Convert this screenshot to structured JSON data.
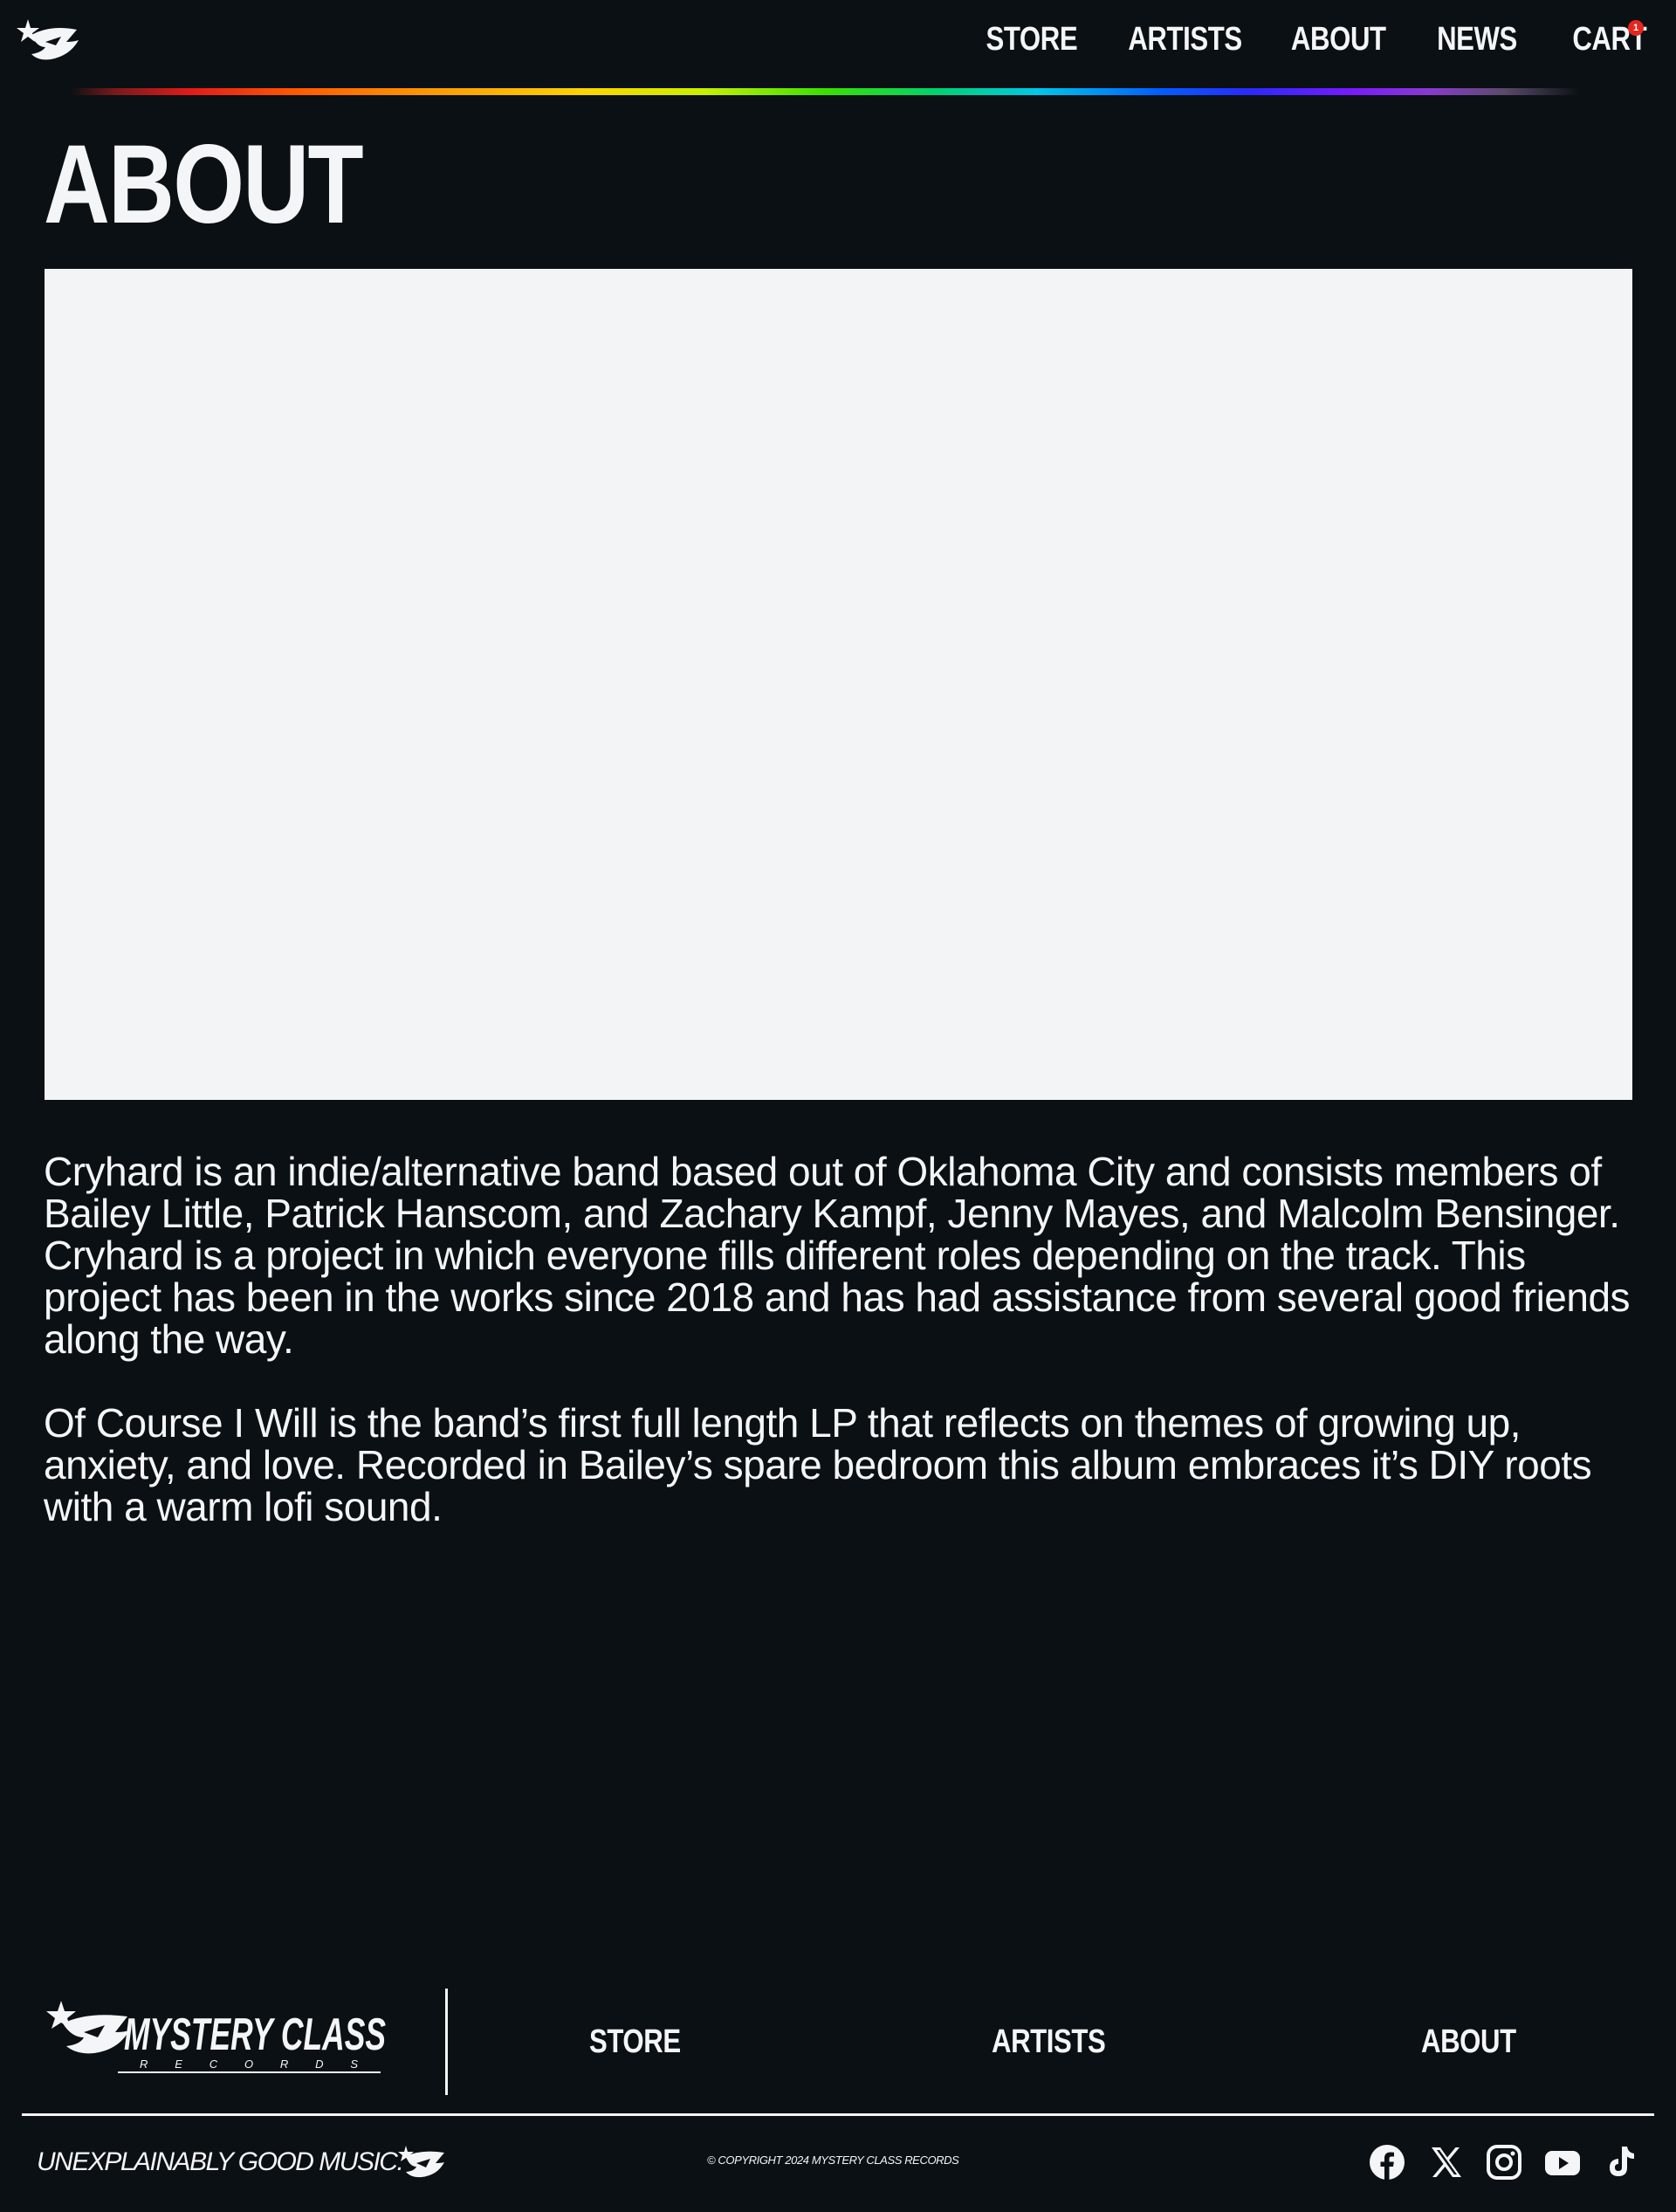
{
  "header": {
    "logo_alt": "Mystery Class Records mark",
    "nav": [
      {
        "label": "STORE"
      },
      {
        "label": "ARTISTS"
      },
      {
        "label": "ABOUT"
      },
      {
        "label": "NEWS"
      },
      {
        "label": "CART"
      }
    ],
    "cart_count": "1"
  },
  "page": {
    "title": "ABOUT",
    "paragraphs": [
      "Cryhard is an indie/alternative band based out of Oklahoma City and consists members of Bailey Little, Patrick Hanscom, and Zachary Kampf, Jenny Mayes, and Malcolm Bensinger. Cryhard is a project in which everyone fills different roles depending on the track. This project has been in the works since 2018 and has had assistance from several good friends along the way.",
      "Of Course I Will is the band’s first full length LP that reflects on themes of growing up, anxiety, and love. Recorded in Bailey’s spare bedroom this album embraces it’s DIY roots with a warm lofi sound."
    ]
  },
  "footer": {
    "logo_text": "MYSTERY CLASS",
    "logo_subtext": "R E C O R D S",
    "links": [
      {
        "label": "STORE"
      },
      {
        "label": "ARTISTS"
      },
      {
        "label": "ABOUT"
      }
    ],
    "tagline": "UNEXPLAINABLY GOOD MUSIC.",
    "copyright": "© COPYRIGHT 2024 MYSTERY CLASS RECORDS",
    "social": [
      "facebook-icon",
      "x-icon",
      "instagram-icon",
      "youtube-icon",
      "tiktok-icon"
    ]
  },
  "colors": {
    "background": "#0a1014",
    "text": "#f4f5f7",
    "media_placeholder": "#f3f4f6",
    "badge": "#e5261f"
  }
}
